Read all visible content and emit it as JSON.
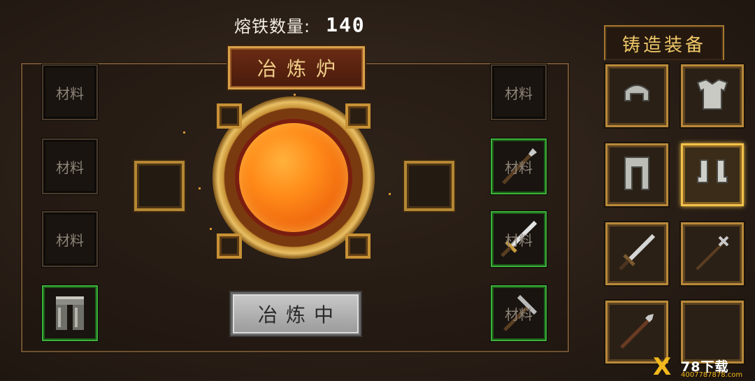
{
  "header": {
    "molten_label": "熔铁数量:",
    "molten_value": "140"
  },
  "furnace": {
    "title": "冶炼炉",
    "status": "冶炼中"
  },
  "left_slots": [
    {
      "label": "材料"
    },
    {
      "label": "材料"
    },
    {
      "label": "材料"
    },
    {
      "label": "",
      "item": "leg-armor-icon",
      "highlight": true
    }
  ],
  "right_slots": [
    {
      "label": "材料"
    },
    {
      "label": "材料",
      "item": "spear-icon",
      "highlight": true
    },
    {
      "label": "材料",
      "item": "sword-icon",
      "highlight": true
    },
    {
      "label": "材料",
      "item": "pickaxe-icon",
      "highlight": true
    }
  ],
  "forge_panel": {
    "title": "铸造装备",
    "items": [
      {
        "icon": "helmet-icon"
      },
      {
        "icon": "chestplate-icon"
      },
      {
        "icon": "leggings-icon"
      },
      {
        "icon": "boots-icon",
        "selected": true
      },
      {
        "icon": "sword-icon"
      },
      {
        "icon": "halberd-icon"
      },
      {
        "icon": "spear-icon"
      },
      {
        "icon": "empty-slot"
      }
    ]
  },
  "watermark": {
    "title": "78下载",
    "url": "4007787878.com"
  },
  "colors": {
    "gold": "#d8a14a",
    "slot_green": "#3fb03a",
    "molten": "#ff8c1a"
  }
}
